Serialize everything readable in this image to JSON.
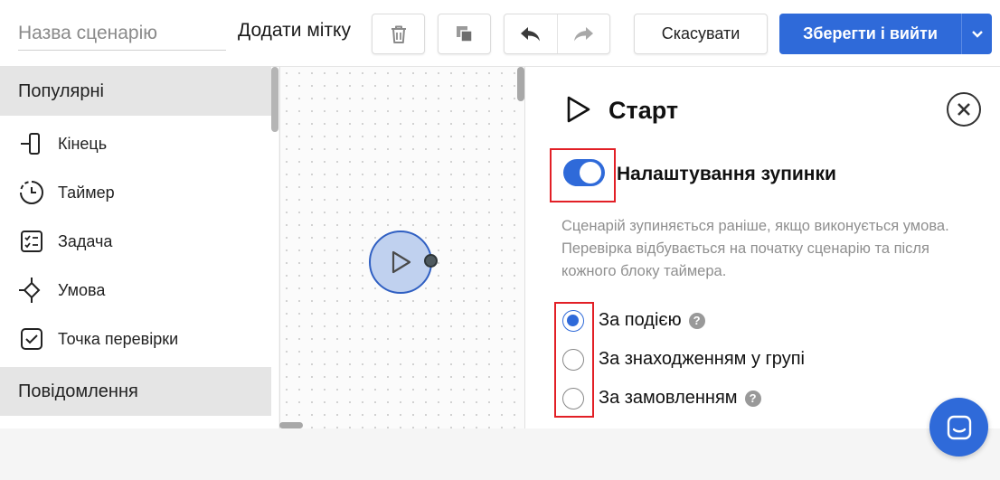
{
  "toolbar": {
    "name_placeholder": "Назва сценарію",
    "add_tag_label": "Додати мітку",
    "cancel_label": "Скасувати",
    "save_label": "Зберегти і вийти",
    "icons": [
      "trash-icon",
      "copy-icon",
      "undo-icon",
      "redo-icon",
      "chevron-down-icon"
    ]
  },
  "sidebar": {
    "section_popular": "Популярні",
    "items": [
      {
        "label": "Кінець",
        "icon": "end-icon"
      },
      {
        "label": "Таймер",
        "icon": "timer-icon"
      },
      {
        "label": "Задача",
        "icon": "task-icon"
      },
      {
        "label": "Умова",
        "icon": "condition-icon"
      },
      {
        "label": "Точка перевірки",
        "icon": "checkpoint-icon"
      }
    ],
    "section_messages": "Повідомлення"
  },
  "canvas": {
    "node_icon": "play-icon"
  },
  "panel": {
    "title": "Старт",
    "toggle_label": "Налаштування зупинки",
    "toggle_on": true,
    "description": "Сценарій зупиняється раніше, якщо виконується умова. Перевірка відбувається на початку сценарію та після кожного блоку таймера.",
    "options": [
      {
        "label": "За подією",
        "checked": true,
        "help": true
      },
      {
        "label": "За знаходженням у групі",
        "checked": false,
        "help": false
      },
      {
        "label": "За замовленням",
        "checked": false,
        "help": true
      }
    ],
    "help_symbol": "?"
  },
  "colors": {
    "accent": "#2f6ad9",
    "highlight": "#e21f26",
    "node_fill": "#c0d1ef"
  }
}
